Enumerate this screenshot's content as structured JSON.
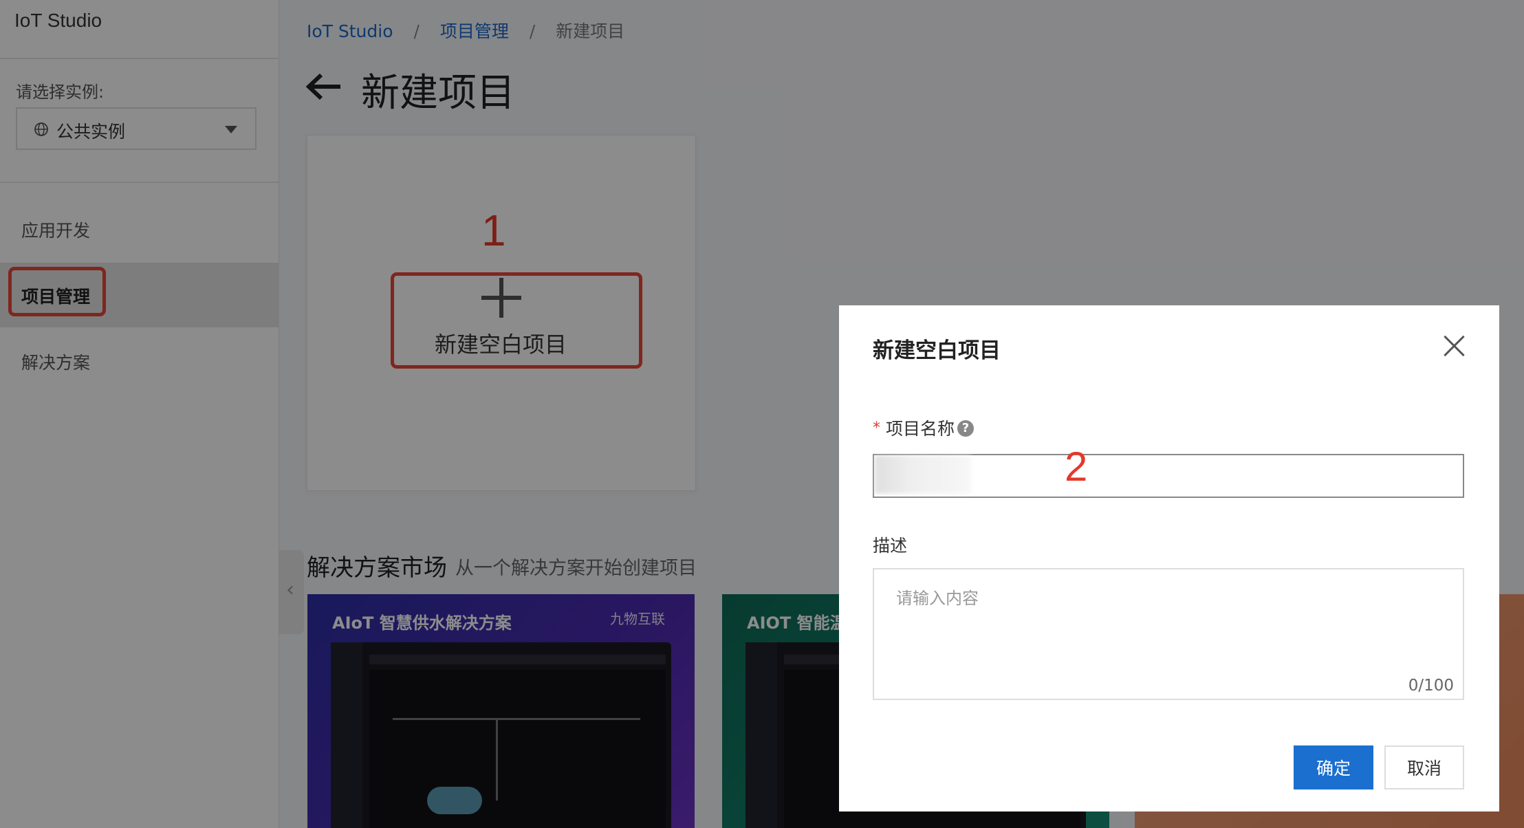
{
  "sidebar": {
    "title": "IoT Studio",
    "instance_label": "请选择实例:",
    "instance_value": "公共实例",
    "nav": [
      {
        "label": "应用开发"
      },
      {
        "label": "项目管理"
      },
      {
        "label": "解决方案"
      }
    ]
  },
  "breadcrumb": {
    "items": [
      "IoT Studio",
      "项目管理",
      "新建项目"
    ],
    "separator": "/"
  },
  "page": {
    "title": "新建项目",
    "new_blank_label": "新建空白项目",
    "step_1": "1",
    "step_2": "2"
  },
  "market": {
    "title": "解决方案市场",
    "subtitle": "从一个解决方案开始创建项目",
    "cards": [
      {
        "title": "AIoT 智慧供水解决方案",
        "logo": "九物互联"
      },
      {
        "title": "AIOT 智能温室"
      }
    ]
  },
  "dialog": {
    "title": "新建空白项目",
    "required_mark": "*",
    "name_label": "项目名称",
    "help_glyph": "?",
    "desc_label": "描述",
    "desc_placeholder": "请输入内容",
    "counter": "0/100",
    "ok_label": "确定",
    "cancel_label": "取消"
  },
  "colors": {
    "accent": "#1b6fcf",
    "highlight": "#e3392d",
    "link": "#1b68c7"
  }
}
